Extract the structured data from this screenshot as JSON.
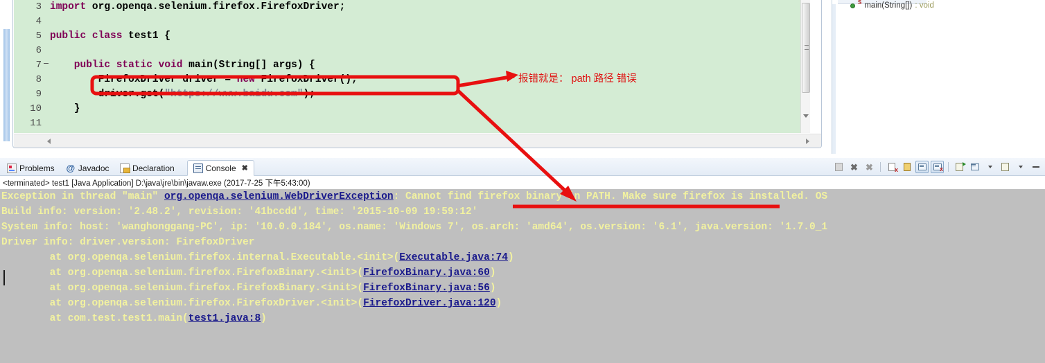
{
  "editor": {
    "language": "java",
    "lines": [
      {
        "num": "3",
        "folded": false,
        "tokens": [
          {
            "t": "import",
            "c": "kw"
          },
          {
            "t": " org.openqa.selenium.firefox.FirefoxDriver;",
            "c": "plain"
          }
        ]
      },
      {
        "num": "4",
        "folded": false,
        "tokens": []
      },
      {
        "num": "5",
        "folded": false,
        "tokens": [
          {
            "t": "public class",
            "c": "kw"
          },
          {
            "t": " test1 {",
            "c": "plain"
          }
        ]
      },
      {
        "num": "6",
        "folded": false,
        "tokens": []
      },
      {
        "num": "7",
        "folded": true,
        "tokens": [
          {
            "t": "    public static void",
            "c": "kw"
          },
          {
            "t": " main(String[] args) {",
            "c": "plain"
          }
        ]
      },
      {
        "num": "8",
        "folded": false,
        "tokens": [
          {
            "t": "        FirefoxDriver driver = ",
            "c": "plain"
          },
          {
            "t": "new",
            "c": "kw"
          },
          {
            "t": " FirefoxDriver();",
            "c": "plain"
          }
        ]
      },
      {
        "num": "9",
        "folded": false,
        "tokens": [
          {
            "t": "        driver.get(",
            "c": "plain"
          },
          {
            "t": "\"https://www.baidu.com\"",
            "c": "str"
          },
          {
            "t": ");",
            "c": "plain"
          }
        ]
      },
      {
        "num": "10",
        "folded": false,
        "tokens": [
          {
            "t": "    }",
            "c": "plain"
          }
        ]
      },
      {
        "num": "11",
        "folded": false,
        "tokens": []
      }
    ]
  },
  "outline": {
    "item_label": "main(String[])",
    "item_return": ": void",
    "static_marker": "S"
  },
  "bottom_tabs": [
    {
      "label": "Problems",
      "icon": "problems-icon",
      "active": false,
      "closable": false
    },
    {
      "label": "Javadoc",
      "icon": "javadoc-icon",
      "active": false,
      "closable": false
    },
    {
      "label": "Declaration",
      "icon": "declaration-icon",
      "active": false,
      "closable": false
    },
    {
      "label": "Console",
      "icon": "console-icon",
      "active": true,
      "closable": true,
      "close_glyph": "✖"
    }
  ],
  "console_toolbar": [
    {
      "name": "terminate-button",
      "glyph": ""
    },
    {
      "name": "remove-launch-button",
      "glyph": "✖"
    },
    {
      "name": "remove-all-terminated-button",
      "glyph": "✖"
    },
    {
      "name": "clear-console-button",
      "glyph": ""
    },
    {
      "name": "scroll-lock-button",
      "glyph": ""
    },
    {
      "name": "show-console-when-output-changes-button",
      "glyph": ""
    },
    {
      "name": "show-console-when-stderr-button",
      "glyph": ""
    },
    {
      "name": "pin-console-button",
      "glyph": ""
    },
    {
      "name": "display-selected-console-button",
      "glyph": ""
    },
    {
      "name": "display-console-dropdown",
      "glyph": "▼"
    },
    {
      "name": "open-console-button",
      "glyph": ""
    },
    {
      "name": "open-console-dropdown",
      "glyph": "▼"
    },
    {
      "name": "minimize-button",
      "glyph": "—"
    }
  ],
  "console": {
    "terminated_line": "<terminated> test1 [Java Application] D:\\java\\jre\\bin\\javaw.exe (2017-7-25 下午5:43:00)",
    "lines": [
      {
        "segments": [
          {
            "text": "Exception in thread \"main\" ",
            "link": false
          },
          {
            "text": "org.openqa.selenium.WebDriverException",
            "link": true
          },
          {
            "text": ": Cannot find firefox binary in PATH. Make sure firefox is installed. OS",
            "link": false
          }
        ]
      },
      {
        "segments": [
          {
            "text": "Build info: version: '2.48.2', revision: '41bccdd', time: '2015-10-09 19:59:12'",
            "link": false
          }
        ]
      },
      {
        "segments": [
          {
            "text": "System info: host: 'wanghonggang-PC', ip: '10.0.0.184', os.name: 'Windows 7', os.arch: 'amd64', os.version: '6.1', java.version: '1.7.0_1",
            "link": false
          }
        ]
      },
      {
        "segments": [
          {
            "text": "Driver info: driver.version: FirefoxDriver",
            "link": false
          }
        ]
      },
      {
        "segments": [
          {
            "text": "        at org.openqa.selenium.firefox.internal.Executable.<init>(",
            "link": false
          },
          {
            "text": "Executable.java:74",
            "link": true
          },
          {
            "text": ")",
            "link": false
          }
        ]
      },
      {
        "segments": [
          {
            "text": "        at org.openqa.selenium.firefox.FirefoxBinary.<init>(",
            "link": false
          },
          {
            "text": "FirefoxBinary.java:60",
            "link": true
          },
          {
            "text": ")",
            "link": false
          }
        ]
      },
      {
        "segments": [
          {
            "text": "        at org.openqa.selenium.firefox.FirefoxBinary.<init>(",
            "link": false
          },
          {
            "text": "FirefoxBinary.java:56",
            "link": true
          },
          {
            "text": ")",
            "link": false
          }
        ]
      },
      {
        "segments": [
          {
            "text": "        at org.openqa.selenium.firefox.FirefoxDriver.<init>(",
            "link": false
          },
          {
            "text": "FirefoxDriver.java:120",
            "link": true
          },
          {
            "text": ")",
            "link": false
          }
        ]
      },
      {
        "segments": [
          {
            "text": "        at com.test.test1.main(",
            "link": false
          },
          {
            "text": "test1.java:8",
            "link": true
          },
          {
            "text": ")",
            "link": false
          }
        ]
      }
    ]
  },
  "annotations": {
    "note_text": "报错就是： path 路径 错误",
    "color": "#e01010"
  }
}
